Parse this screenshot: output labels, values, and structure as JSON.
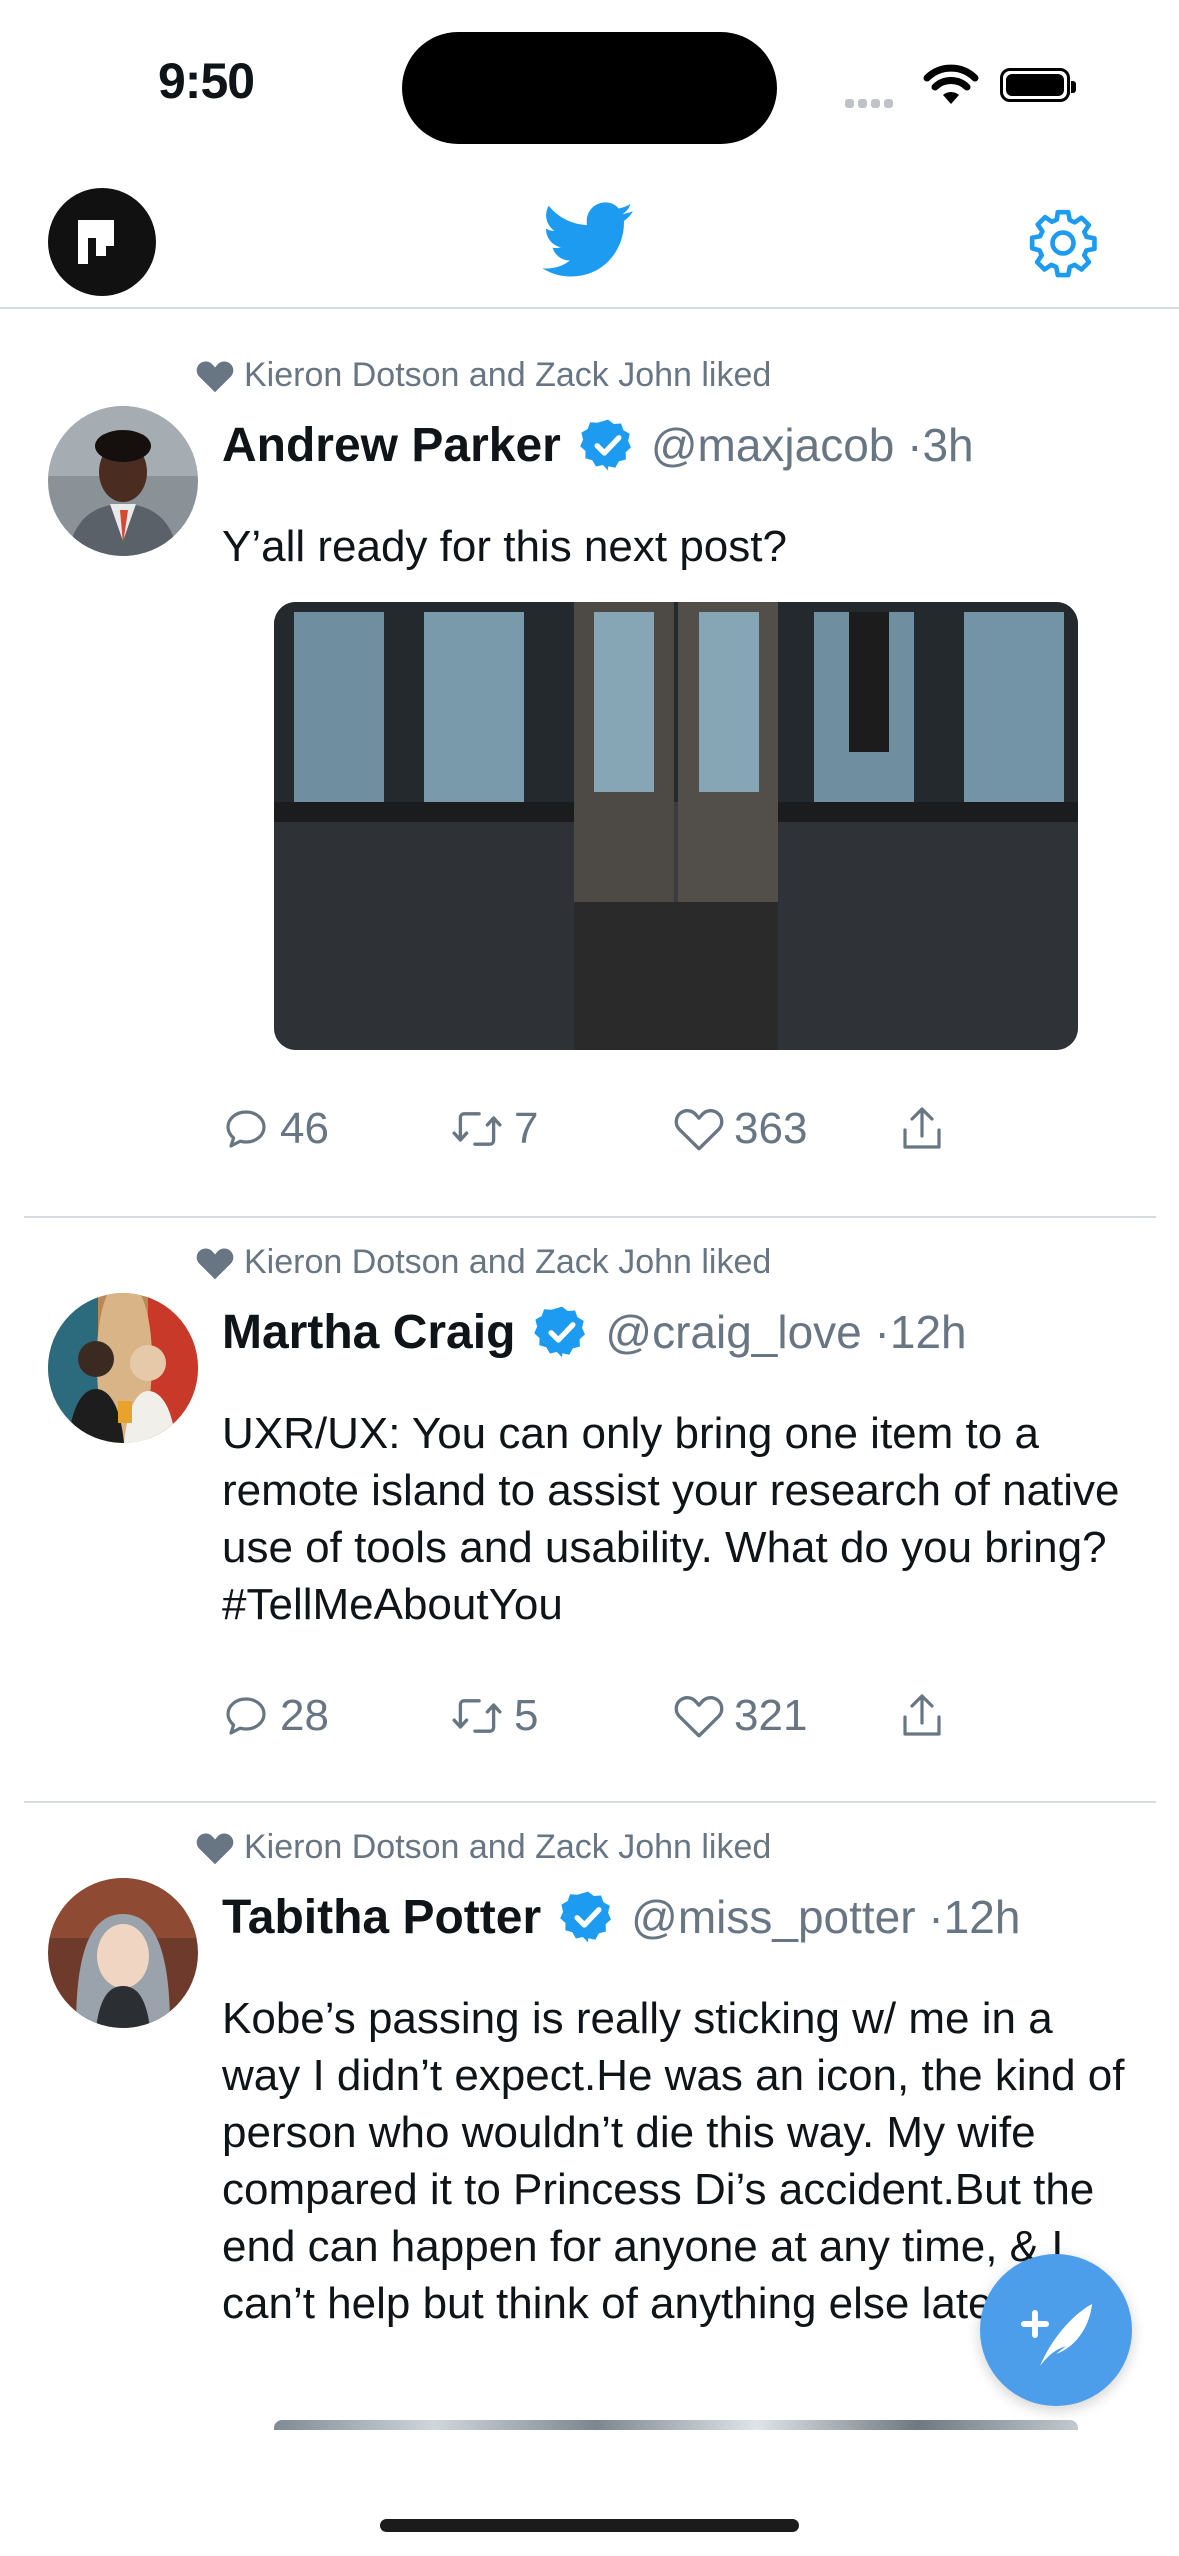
{
  "status_bar": {
    "time": "9:50"
  },
  "colors": {
    "brand": "#1d9bf0",
    "muted": "#687684",
    "fab": "#4c9eeb"
  },
  "header": {
    "left_icon": "app-logo-icon",
    "center_icon": "twitter-bird-icon",
    "right_icon": "gear-icon"
  },
  "tweets": [
    {
      "liked_by": "Kieron Dotson and Zack John liked",
      "name": "Andrew Parker",
      "handle": "@maxjacob ·3h",
      "text": "Y’all ready for this next post?",
      "has_image": true,
      "replies": "46",
      "retweets": "7",
      "likes": "363"
    },
    {
      "liked_by": "Kieron Dotson and Zack John liked",
      "name": "Martha Craig",
      "handle": "@craig_love ·12h",
      "text": "UXR/UX: You can only bring one item to a remote island to assist your research of native use of tools and usability. What do you bring? #TellMeAboutYou",
      "has_image": false,
      "replies": "28",
      "retweets": "5",
      "likes": "321"
    },
    {
      "liked_by": "Kieron Dotson and Zack John liked",
      "name": "Tabitha Potter",
      "handle": "@miss_potter ·12h",
      "text": "Kobe’s passing is really sticking w/ me in a way I didn’t expect.He was an icon, the kind of person who wouldn’t die this way. My wife compared it to Princess Di’s accident.But the end can happen for anyone at any time, & I can’t help but think of anything else lately."
    }
  ]
}
